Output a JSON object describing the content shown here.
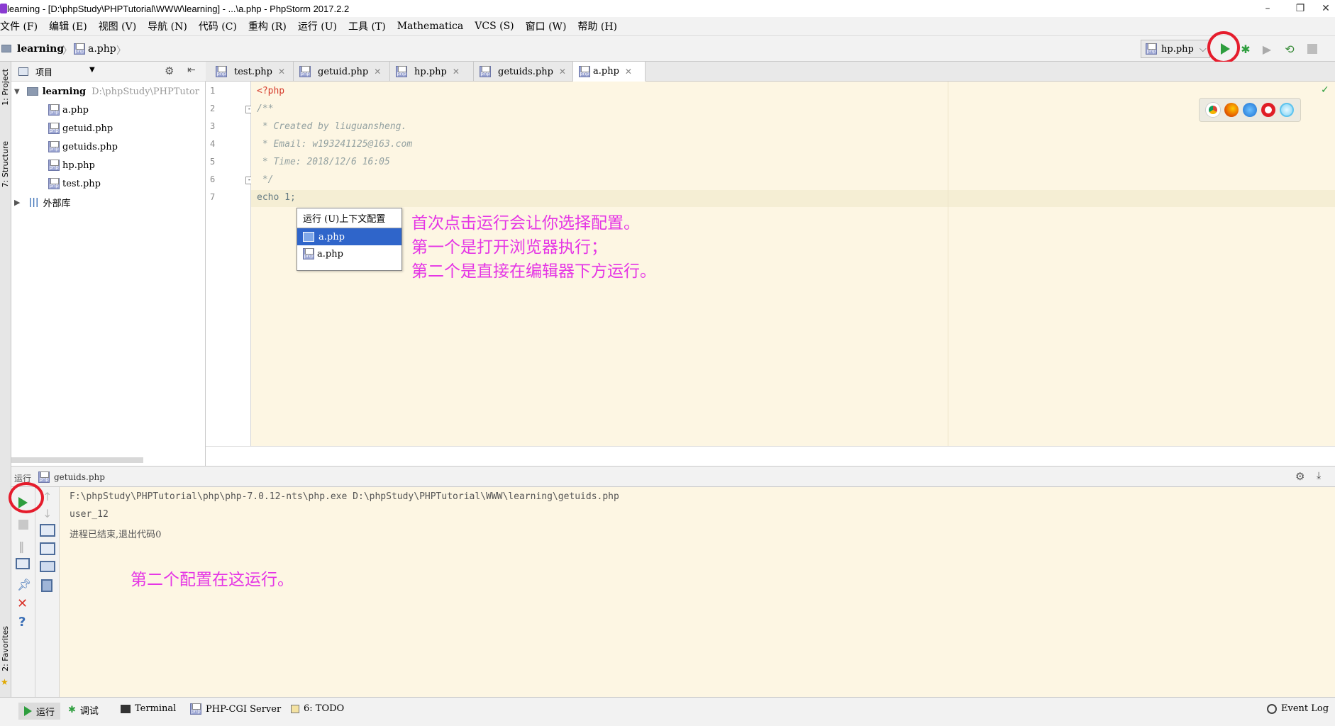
{
  "window": {
    "title": "learning - [D:\\phpStudy\\PHPTutorial\\WWW\\learning] - ...\\a.php - PhpStorm 2017.2.2",
    "minimize": "–",
    "restore": "❐",
    "close": "✕"
  },
  "menu": [
    "文件 (F)",
    "编辑 (E)",
    "视图 (V)",
    "导航 (N)",
    "代码 (C)",
    "重构 (R)",
    "运行 (U)",
    "工具 (T)",
    "Mathematica",
    "VCS (S)",
    "窗口 (W)",
    "帮助 (H)"
  ],
  "breadcrumb": {
    "project": "learning",
    "file": "a.php"
  },
  "run_config": {
    "selected": "hp.php"
  },
  "left_tool_tabs": {
    "project": "1: Project",
    "structure": "7: Structure",
    "favorites": "2: Favorites"
  },
  "project_panel": {
    "view_label": "项目",
    "root": {
      "name": "learning",
      "path": "D:\\phpStudy\\PHPTutor"
    },
    "files": [
      "a.php",
      "getuid.php",
      "getuids.php",
      "hp.php",
      "test.php"
    ],
    "external_libs": "外部库"
  },
  "tabs": [
    {
      "label": "test.php"
    },
    {
      "label": "getuid.php"
    },
    {
      "label": "hp.php"
    },
    {
      "label": "getuids.php"
    },
    {
      "label": "a.php"
    }
  ],
  "editor": {
    "lines": [
      {
        "n": "1",
        "text": "<?php"
      },
      {
        "n": "2",
        "text": "/**"
      },
      {
        "n": "3",
        "text": " * Created by liuguansheng."
      },
      {
        "n": "4",
        "text": " * Email: w193241125@163.com"
      },
      {
        "n": "5",
        "text": " * Time: 2018/12/6 16:05"
      },
      {
        "n": "6",
        "text": " */"
      },
      {
        "n": "7",
        "text": "echo 1;"
      }
    ]
  },
  "popup": {
    "header": "运行 (U)上下文配置",
    "items": [
      "a.php",
      "a.php"
    ]
  },
  "annotations": {
    "editor": [
      "首次点击运行会让你选择配置。",
      "第一个是打开浏览器执行；",
      "第二个是直接在编辑器下方运行。"
    ],
    "console": "第二个配置在这运行。"
  },
  "run_panel": {
    "title": "运行",
    "config": "getuids.php",
    "output": [
      "F:\\phpStudy\\PHPTutorial\\php\\php-7.0.12-nts\\php.exe D:\\phpStudy\\PHPTutorial\\WWW\\learning\\getuids.php",
      "user_12",
      "进程已结束,退出代码0"
    ]
  },
  "statusbar": {
    "run": "运行",
    "debug": "调试",
    "terminal": "Terminal",
    "phpcgi": "PHP-CGI Server",
    "todo": "6: TODO",
    "eventlog": "Event Log"
  },
  "colors": {
    "accent_red": "#e51c2c",
    "run_green": "#2e9e3e",
    "annotation": "#e535e5",
    "selection": "#2f65ca"
  }
}
